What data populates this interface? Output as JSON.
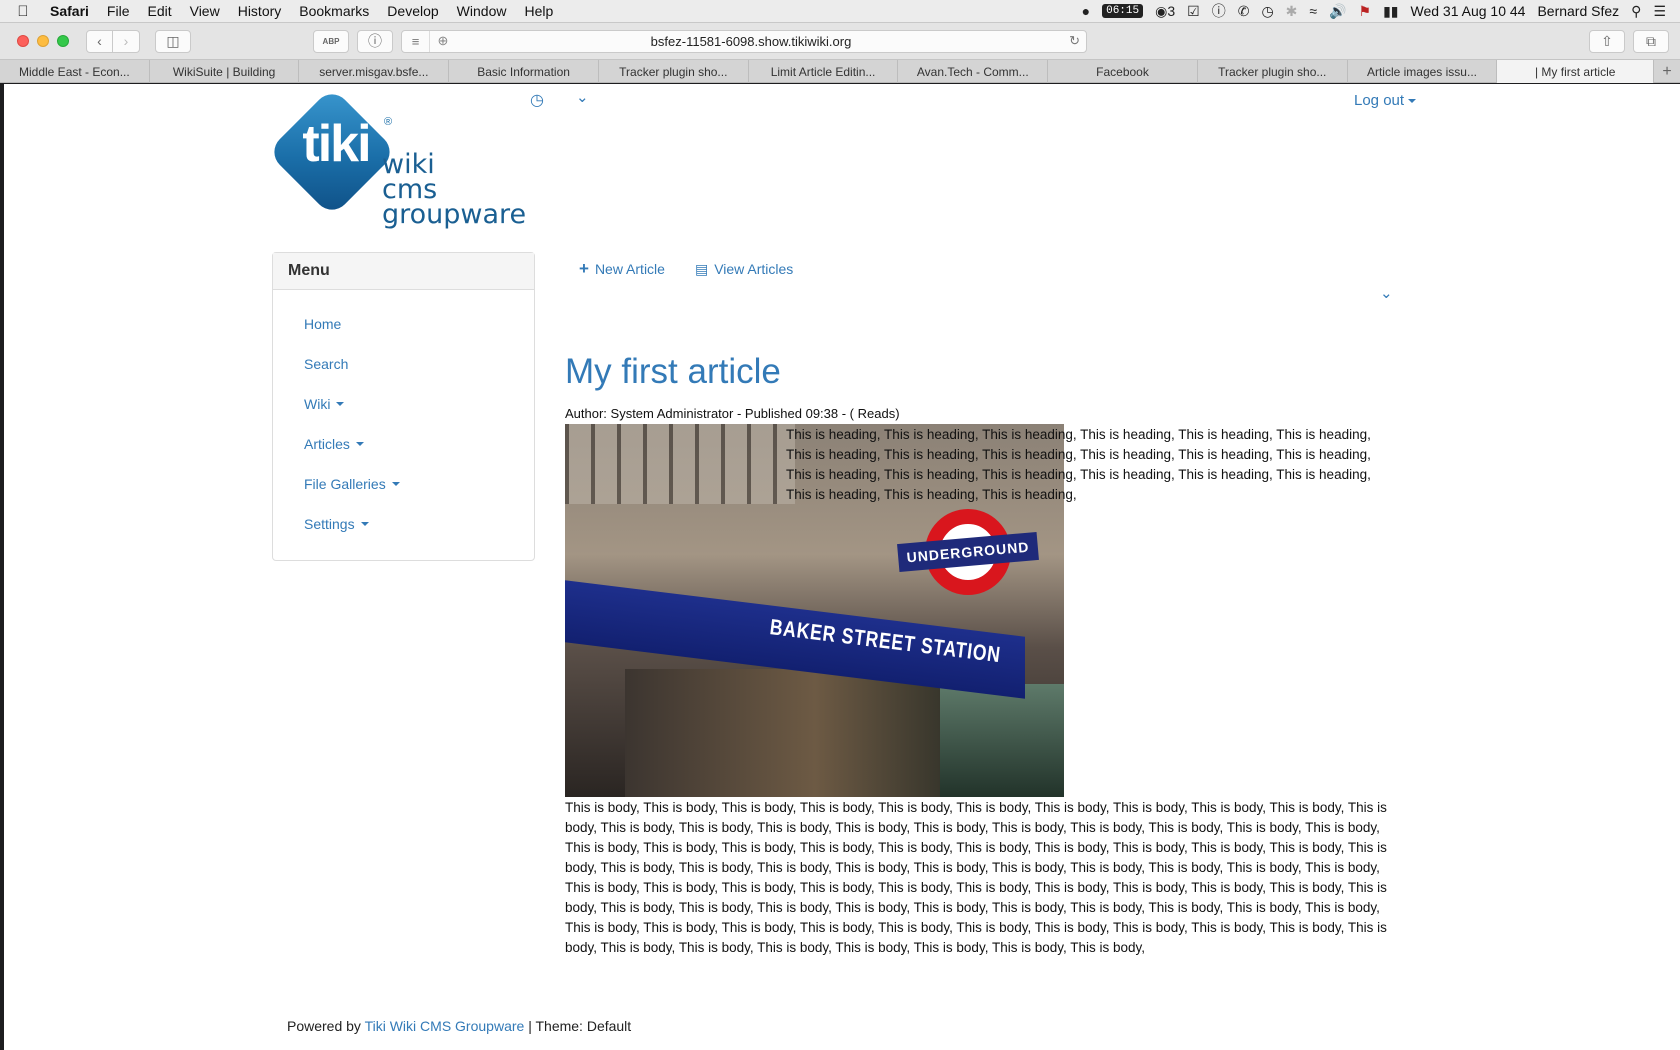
{
  "menubar": {
    "app": "Safari",
    "items": [
      "File",
      "Edit",
      "View",
      "History",
      "Bookmarks",
      "Develop",
      "Window",
      "Help"
    ],
    "timer": "06:15",
    "badge_count": "3",
    "datetime": "Wed 31 Aug 10 44",
    "user": "Bernard Sfez"
  },
  "toolbar": {
    "url": "bsfez-11581-6098.show.tikiwiki.org",
    "abp_label": "ABP"
  },
  "tabs": [
    "Middle East - Econ...",
    "WikiSuite | Building",
    "server.misgav.bsfe...",
    "Basic Information",
    "Tracker plugin sho...",
    "Limit Article Editin...",
    "Avan.Tech - Comm...",
    "Facebook",
    "Tracker plugin sho...",
    "Article images issu...",
    "| My first article"
  ],
  "logo": {
    "word": "tiki",
    "reg": "®",
    "line1": "wiki",
    "line2": "cms",
    "line3": "groupware"
  },
  "header": {
    "logout": "Log out"
  },
  "menu": {
    "title": "Menu",
    "items": [
      {
        "label": "Home",
        "dropdown": false
      },
      {
        "label": "Search",
        "dropdown": false
      },
      {
        "label": "Wiki",
        "dropdown": true
      },
      {
        "label": "Articles",
        "dropdown": true
      },
      {
        "label": "File Galleries",
        "dropdown": true
      },
      {
        "label": "Settings",
        "dropdown": true
      }
    ]
  },
  "actions": {
    "new_article": "New Article",
    "view_articles": "View Articles"
  },
  "article": {
    "title": "My first article",
    "meta": "Author: System Administrator - Published 09:38 - ( Reads)",
    "image_texts": {
      "station": "BAKER STREET STATION",
      "sign": "UNDERGROUND"
    },
    "heading": "This is heading, This is heading, This is heading, This is heading, This is heading, This is heading, This is heading, This is heading, This is heading, This is heading, This is heading, This is heading, This is heading, This is heading, This is heading, This is heading, This is heading, This is heading, This is heading, This is heading, This is heading,",
    "body": "This is body, This is body, This is body, This is body, This is body, This is body, This is body, This is body, This is body, This is body, This is body, This is body, This is body, This is body, This is body, This is body, This is body, This is body, This is body, This is body, This is body, This is body, This is body, This is body, This is body, This is body, This is body, This is body, This is body, This is body, This is body, This is body, This is body, This is body, This is body, This is body, This is body, This is body, This is body, This is body, This is body, This is body, This is body, This is body, This is body, This is body, This is body, This is body, This is body, This is body, This is body, This is body, This is body, This is body, This is body, This is body, This is body, This is body, This is body, This is body, This is body, This is body, This is body, This is body, This is body, This is body, This is body, This is body, This is body, This is body, This is body, This is body, This is body, This is body, This is body, This is body, This is body, This is body, This is body, This is body, This is body,"
  },
  "footer": {
    "prefix": "Powered by",
    "link": "Tiki Wiki CMS Groupware",
    "suffix": "| Theme: Default"
  }
}
